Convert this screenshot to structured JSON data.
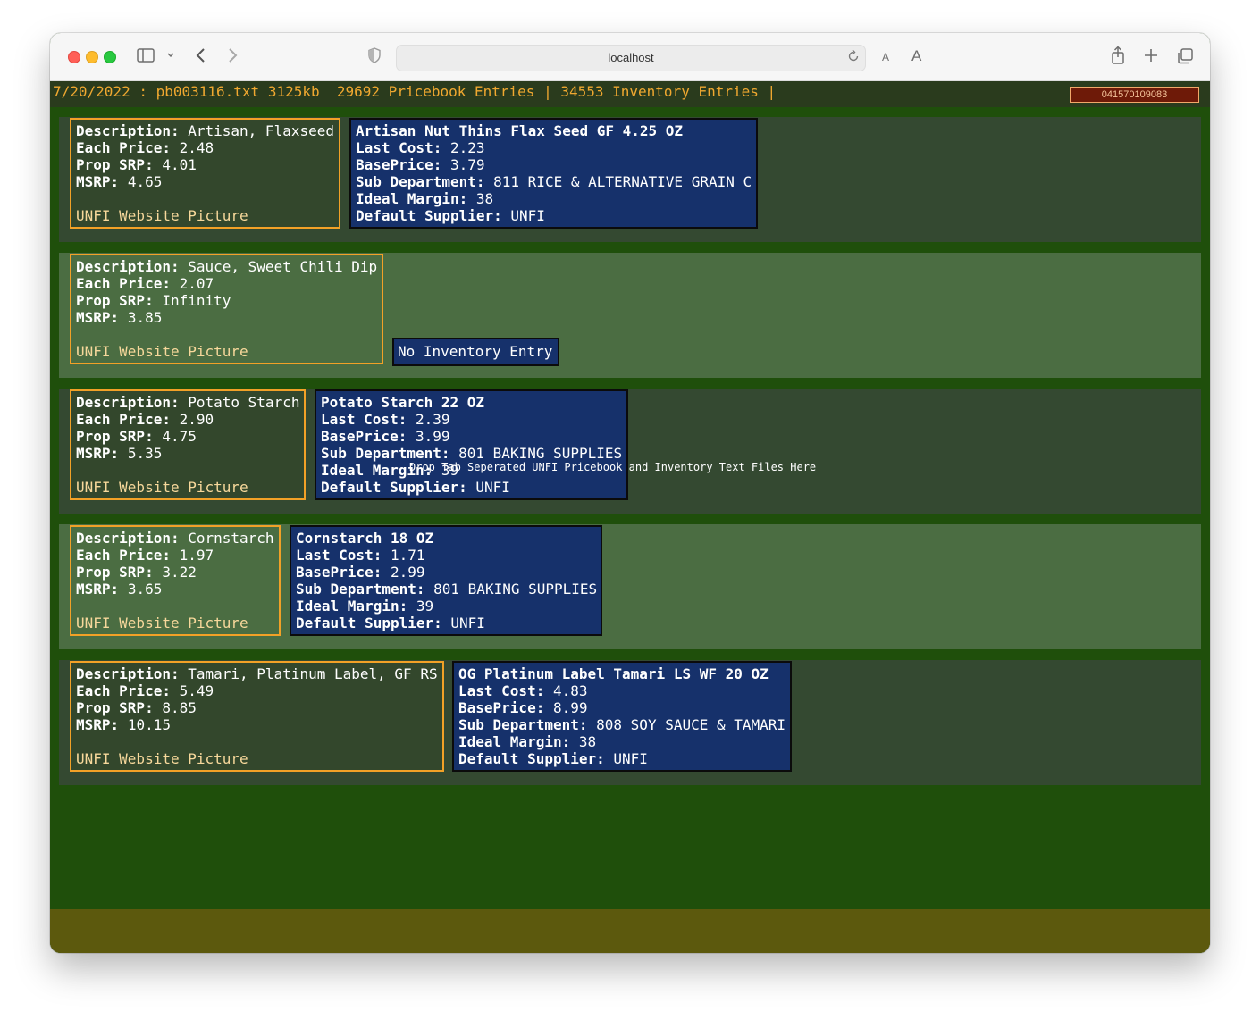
{
  "browser": {
    "url": "localhost",
    "text_small": "A",
    "text_large": "A"
  },
  "status": {
    "text": "7/20/2022 : pb003116.txt 3125kb  29692 Pricebook Entries | 34553 Inventory Entries |",
    "scan_value": "041570109083"
  },
  "drop_hint": "Drop Tab Seperated UNFI Pricebook and Inventory Text Files Here",
  "labels": {
    "description": "Description:",
    "each_price": "Each Price:",
    "prop_srp": "Prop SRP:",
    "msrp": "MSRP:",
    "link": "UNFI Website Picture",
    "last_cost": "Last Cost:",
    "base_price": "BasePrice:",
    "sub_department": "Sub Department:",
    "ideal_margin": "Ideal Margin:",
    "default_supplier": "Default Supplier:",
    "no_inventory": "No Inventory Entry"
  },
  "entries": [
    {
      "pricebook": {
        "description": "Artisan, Flaxseed",
        "each_price": "2.48",
        "prop_srp": "4.01",
        "msrp": "4.65"
      },
      "inventory": {
        "title": "Artisan Nut Thins Flax Seed GF 4.25 OZ",
        "last_cost": "2.23",
        "base_price": "3.79",
        "sub_department": "811 RICE & ALTERNATIVE GRAIN C",
        "ideal_margin": "38",
        "default_supplier": "UNFI"
      }
    },
    {
      "pricebook": {
        "description": "Sauce, Sweet Chili Dip",
        "each_price": "2.07",
        "prop_srp": "Infinity",
        "msrp": "3.85"
      },
      "inventory": null
    },
    {
      "pricebook": {
        "description": "Potato Starch",
        "each_price": "2.90",
        "prop_srp": "4.75",
        "msrp": "5.35"
      },
      "inventory": {
        "title": "Potato Starch 22 OZ",
        "last_cost": "2.39",
        "base_price": "3.99",
        "sub_department": "801 BAKING SUPPLIES",
        "ideal_margin": "39",
        "default_supplier": "UNFI"
      }
    },
    {
      "pricebook": {
        "description": "Cornstarch",
        "each_price": "1.97",
        "prop_srp": "3.22",
        "msrp": "3.65"
      },
      "inventory": {
        "title": "Cornstarch 18 OZ",
        "last_cost": "1.71",
        "base_price": "2.99",
        "sub_department": "801 BAKING SUPPLIES",
        "ideal_margin": "39",
        "default_supplier": "UNFI"
      }
    },
    {
      "pricebook": {
        "description": "Tamari, Platinum Label, GF RS",
        "each_price": "5.49",
        "prop_srp": "8.85",
        "msrp": "10.15"
      },
      "inventory": {
        "title": "OG Platinum Label Tamari LS WF 20 OZ",
        "last_cost": "4.83",
        "base_price": "8.99",
        "sub_department": "808 SOY SAUCE & TAMARI",
        "ideal_margin": "38",
        "default_supplier": "UNFI"
      }
    }
  ]
}
